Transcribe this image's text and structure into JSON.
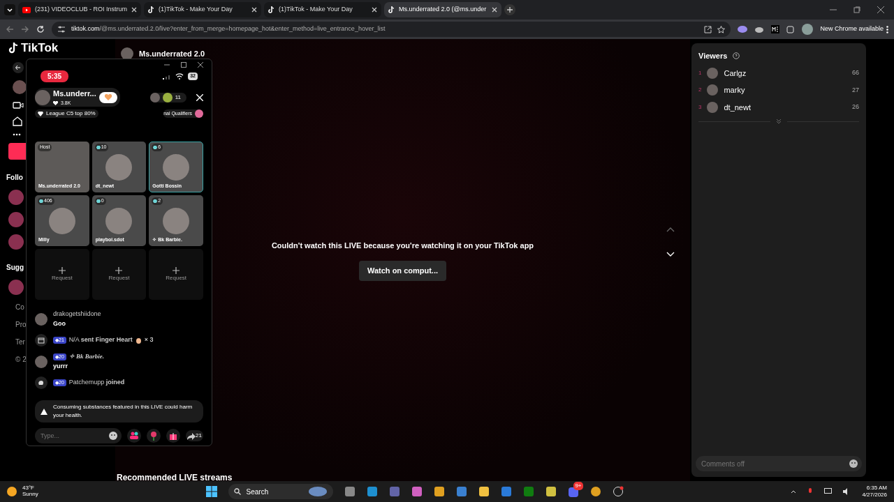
{
  "browser": {
    "tabs": [
      {
        "title": "(231) VIDEOCLUB - ROI Instrum",
        "kind": "youtube",
        "selected": false
      },
      {
        "title": "(1)TikTok - Make Your Day",
        "kind": "tiktok",
        "selected": false
      },
      {
        "title": "(1)TikTok - Make Your Day",
        "kind": "tiktok",
        "selected": false
      },
      {
        "title": "Ms.underrated 2.0 (@ms.under",
        "kind": "tiktok",
        "selected": true
      }
    ],
    "url_host": "tiktok.com",
    "url_path": "/@ms.underrated.2.0/live?enter_from_merge=homepage_hot&enter_method=live_entrance_hover_list",
    "update_label": "New Chrome available"
  },
  "site": {
    "logo": "TikTok",
    "streamer": "Ms.underrated 2.0",
    "sidebar_labels": [
      "Follo",
      "Sugg"
    ],
    "footer_links": [
      "Co",
      "Pro",
      "Ter",
      "© 2"
    ],
    "recommended_title": "Recommended LIVE streams"
  },
  "phone": {
    "time": "5:35",
    "battery": "32",
    "host_name": "Ms.underr...",
    "likes": "3.8K",
    "league": "League C5 top 80%",
    "viewer_count": "11",
    "event_banner": "nal Qualifiers",
    "guests": [
      {
        "badge": "Host",
        "name": "Ms.underrated 2.0",
        "kind": "host",
        "selected": false
      },
      {
        "badge": "10",
        "name": "dt_newt",
        "kind": "guest",
        "selected": false
      },
      {
        "badge": "6",
        "name": "Gotti Bossin",
        "kind": "guest",
        "selected": true
      },
      {
        "badge": "406",
        "name": "Milly",
        "kind": "guest",
        "selected": false
      },
      {
        "badge": "0",
        "name": "playboi.sdot",
        "kind": "guest",
        "selected": false
      },
      {
        "badge": "2",
        "name": "✧ Bk Barbie.",
        "kind": "guest",
        "selected": false
      }
    ],
    "request_slots": [
      "Request",
      "Request",
      "Request"
    ],
    "chat": [
      {
        "kind": "comment",
        "user": "drakogetshiidone",
        "text": "Goo"
      },
      {
        "kind": "gift",
        "level": "◆21",
        "text": "N/A **sent Finger Heart**",
        "count": "× 3"
      },
      {
        "kind": "comment",
        "level": "◆20",
        "user": "✧ Bk Barbie.",
        "text": "yurrr"
      },
      {
        "kind": "join",
        "level": "◆20",
        "text": "Patchemupp **joined**"
      }
    ],
    "warning": "Consuming substances featured in this LIVE could harm your health.",
    "input": {
      "placeholder": "Type..."
    },
    "share_count": "21"
  },
  "player": {
    "message": "Couldn't watch this LIVE because you're watching it on your TikTok app",
    "button": "Watch on comput..."
  },
  "viewers": {
    "title": "Viewers",
    "items": [
      {
        "rank": "1",
        "name": "Carlgz",
        "score": "66"
      },
      {
        "rank": "2",
        "name": "marky",
        "score": "27"
      },
      {
        "rank": "3",
        "name": "dt_newt",
        "score": "26"
      }
    ],
    "comment_field": {
      "placeholder": "Comments off"
    }
  },
  "taskbar": {
    "temperature": "43°F",
    "weather": "Sunny",
    "search": "Search",
    "notification_badge": "9+",
    "time": "6:35 AM",
    "date": "4/27/2026"
  }
}
